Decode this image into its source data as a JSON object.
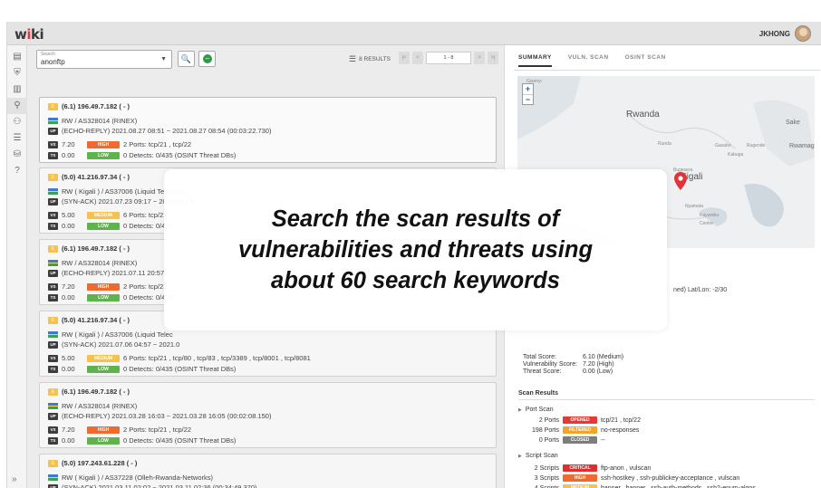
{
  "app": {
    "logo_prefix": "w",
    "logo_mid": "i",
    "logo_suffix": "ki",
    "user": "JKHONG"
  },
  "sidebar": {
    "icons": [
      "dashboard-icon",
      "scan-icon",
      "chart-icon",
      "search-icon",
      "users-icon",
      "list-icon",
      "database-icon",
      "help-icon"
    ],
    "glyphs": [
      "▤",
      "⛨",
      "▥",
      "⚲",
      "⚇",
      "☰",
      "⛁",
      "?"
    ],
    "active_index": 3,
    "collapse": "»"
  },
  "toolbar": {
    "search_label": "Search",
    "search_value": "anonftp",
    "search_btn": "🔍",
    "go_btn": "–",
    "results": "8 RESULTS",
    "pager_first": "|<",
    "pager_prev": "<",
    "pager_range": "1 - 8",
    "pager_next": ">",
    "pager_last": ">|"
  },
  "cards": [
    {
      "ip": "(6.1) 196.49.7.182 ( - )",
      "asn": "RW / AS328014 (RINEX)",
      "type_tag": "UP",
      "time": "(ECHO-REPLY)  2021.08.27 08:51 ~ 2021.08.27 08:54 (00:03:22.730)",
      "vs": "7.20",
      "vs_sev": "HIGH",
      "ports": "2 Ports:  tcp/21 , tcp/22",
      "ts": "0.00",
      "ts_sev": "LOW",
      "detects": "0 Detects: 0/435 (OSINT Threat DBs)"
    },
    {
      "ip": "(5.0) 41.216.97.34 ( - )",
      "asn": "RW ( Kigali ) / AS37006 (Liquid Telecom)",
      "type_tag": "UP",
      "time": "(SYN-ACK)  2021.07.23 09:17 ~ 2021.07.23",
      "vs": "5.00",
      "vs_sev": "MEDIUM",
      "ports": "6 Ports:  tcp/21",
      "ts": "0.00",
      "ts_sev": "LOW",
      "detects": "0 Detects: 0/435"
    },
    {
      "ip": "(6.1) 196.49.7.182 ( - )",
      "asn": "RW / AS328014 (RINEX)",
      "type_tag": "UP",
      "time": "(ECHO-REPLY)  2021.07.11 20:57 ~",
      "vs": "7.20",
      "vs_sev": "HIGH",
      "ports": "2 Ports:  tcp/21",
      "ts": "0.00",
      "ts_sev": "LOW",
      "detects": "0 Detects: 0/435"
    },
    {
      "ip": "(5.0) 41.216.97.34 ( - )",
      "asn": "RW ( Kigali ) / AS37006 (Liquid Telec",
      "type_tag": "UP",
      "time": "(SYN-ACK)  2021.07.06 04:57 ~ 2021.0",
      "vs": "5.00",
      "vs_sev": "MEDIUM",
      "ports": "6 Ports:  tcp/21 , tcp/80 , tcp/83 , tcp/3389 , tcp/8001 , tcp/8081",
      "ts": "0.00",
      "ts_sev": "LOW",
      "detects": "0 Detects: 0/435 (OSINT Threat DBs)"
    },
    {
      "ip": "(6.1) 196.49.7.182 ( - )",
      "asn": "RW / AS328014 (RINEX)",
      "type_tag": "UP",
      "time": "(ECHO-REPLY)  2021.03.28 16:03 ~ 2021.03.28 16:05 (00:02:08.150)",
      "vs": "7.20",
      "vs_sev": "HIGH",
      "ports": "2 Ports:  tcp/21 , tcp/22",
      "ts": "0.00",
      "ts_sev": "LOW",
      "detects": "0 Detects: 0/435 (OSINT Threat DBs)"
    },
    {
      "ip": "(5.0) 197.243.61.228 ( - )",
      "asn": "RW ( Kigali ) / AS37228 (Olleh-Rwanda-Networks)",
      "type_tag": "UP",
      "time": "(SYN-ACK)  2021.03.11 02:02 ~ 2021.03.11 02:36 (00:34:49.370)",
      "vs": "",
      "vs_sev": "",
      "ports": "",
      "ts": "",
      "ts_sev": "",
      "detects": ""
    }
  ],
  "card_tags": {
    "vs": "VS",
    "ts": "TS",
    "ip_badge": "E"
  },
  "detail": {
    "tabs": [
      "SUMMARY",
      "VULN. SCAN",
      "OSINT SCAN"
    ],
    "active_tab": 0,
    "map": {
      "zoom_in": "+",
      "zoom_out": "−",
      "country": "Rwanda",
      "city": "Kigali",
      "labels_small": [
        "Runda",
        "Gasabo",
        "Rugende",
        "Kabuga",
        "Bugesera",
        "Nyamata",
        "Kayumbu",
        "Centre",
        "Sake",
        "Rwamagana",
        "Gisenyi"
      ]
    },
    "location_text": "ned) Lat/Lon: -2/30",
    "scores": [
      {
        "k": "Total Score:",
        "v": "6.10 (Medium)"
      },
      {
        "k": "Vulnerability Score:",
        "v": "7.20 (High)"
      },
      {
        "k": "Threat Score:",
        "v": "0.00 (Low)"
      }
    ],
    "scan_results_title": "Scan Results",
    "port_scan": {
      "title": "Port Scan",
      "rows": [
        {
          "count": "2 Ports",
          "tag": "OPENED",
          "cls": "opened",
          "text": "tcp/21 , tcp/22"
        },
        {
          "count": "198 Ports",
          "tag": "FILTERED",
          "cls": "filtered",
          "text": "no-responses"
        },
        {
          "count": "0 Ports",
          "tag": "CLOSED",
          "cls": "closed",
          "text": "--"
        }
      ]
    },
    "script_scan": {
      "title": "Script Scan",
      "rows": [
        {
          "count": "2 Scripts",
          "tag": "CRITICAL",
          "cls": "critical",
          "text": "ftp-anon , vulscan"
        },
        {
          "count": "3 Scripts",
          "tag": "HIGH",
          "cls": "high",
          "text": "ssh-hostkey , ssh-publickey-acceptance , vulscan"
        },
        {
          "count": "4 Scripts",
          "tag": "MEDIUM",
          "cls": "medium",
          "text": "banner , banner , ssh-auth-methods , ssh2-enum-algos"
        }
      ]
    }
  },
  "overlay": {
    "line1": "Search the scan results of",
    "line2": "vulnerabilities and threats using",
    "line3": "about 60 search keywords"
  },
  "colors": {
    "high": "#ef6a2e",
    "medium": "#f4c24d",
    "low": "#5eb34d",
    "opened": "#e53935",
    "pin": "#e0343a"
  }
}
